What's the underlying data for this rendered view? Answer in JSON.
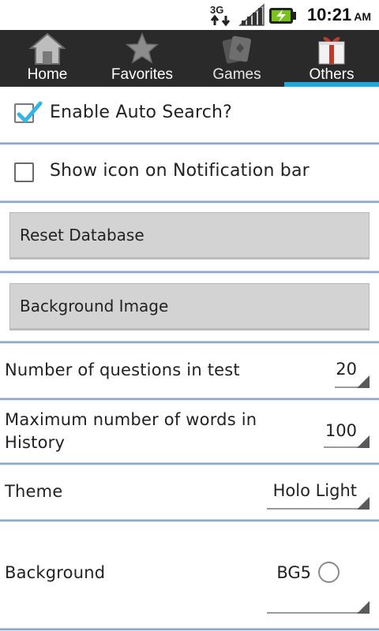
{
  "status_bar": {
    "network_type": "3G",
    "time": "10:21",
    "ampm": "AM"
  },
  "tabs": [
    {
      "label": "Home",
      "icon": "home-icon",
      "selected": false
    },
    {
      "label": "Favorites",
      "icon": "star-icon",
      "selected": false
    },
    {
      "label": "Games",
      "icon": "cards-icon",
      "selected": false
    },
    {
      "label": "Others",
      "icon": "gift-icon",
      "selected": true
    }
  ],
  "prefs": {
    "auto_search": {
      "label": "Enable Auto Search?",
      "checked": true
    },
    "notification_icon": {
      "label": "Show icon on Notification bar",
      "checked": false
    },
    "reset_database": {
      "label": "Reset Database"
    },
    "background_image": {
      "label": "Background Image"
    },
    "questions_in_test": {
      "label": "Number of questions in test",
      "value": "20"
    },
    "max_history": {
      "label": "Maximum number of words in History",
      "value": "100"
    },
    "theme": {
      "label": "Theme",
      "value": "Holo Light"
    },
    "background": {
      "label": "Background",
      "value": "BG5",
      "selected": false
    }
  },
  "colors": {
    "tab_indicator": "#1fa8dc",
    "tabbar_bg": "#2a2a2a",
    "checkbox_check": "#33b5e5",
    "divider": "#8da8c8"
  }
}
